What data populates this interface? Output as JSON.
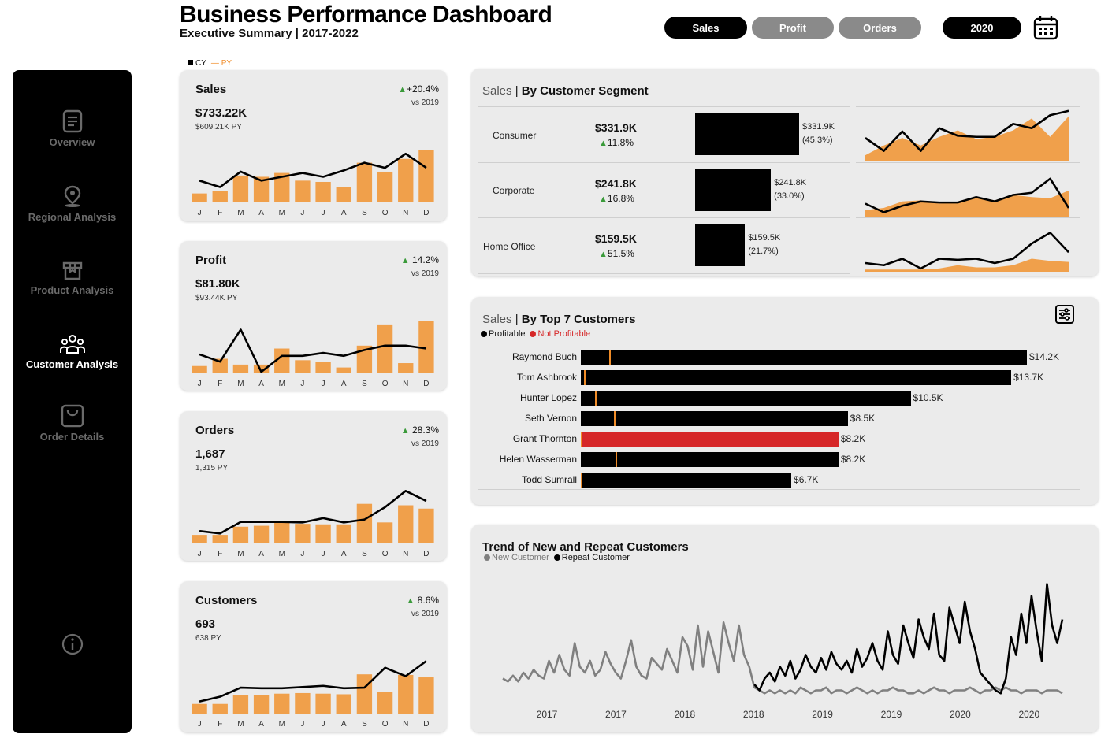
{
  "header": {
    "title": "Business Performance Dashboard",
    "subtitle": "Executive Summary | 2017-2022",
    "metric_tabs": [
      {
        "label": "Sales",
        "active": true
      },
      {
        "label": "Profit",
        "active": false
      },
      {
        "label": "Orders",
        "active": false
      }
    ],
    "year_label": "2020",
    "calendar_icon": "calendar-icon"
  },
  "legend": {
    "cy": "CY",
    "py": "PY",
    "py_color": "#f08c28"
  },
  "sidebar": {
    "items": [
      {
        "label": "Overview",
        "icon": "document-icon",
        "active": false
      },
      {
        "label": "Regional Analysis",
        "icon": "map-pin-icon",
        "active": false
      },
      {
        "label": "Product Analysis",
        "icon": "box-icon",
        "active": false
      },
      {
        "label": "Customer Analysis",
        "icon": "users-icon",
        "active": true
      },
      {
        "label": "Order Details",
        "icon": "shopping-bag-icon",
        "active": false
      }
    ],
    "info_icon": "info-icon"
  },
  "kpis": [
    {
      "name": "Sales",
      "value": "$733.22K",
      "py": "$609.21K PY",
      "delta": "+20.4%",
      "vs": "vs 2019",
      "months": [
        "J",
        "F",
        "M",
        "A",
        "M",
        "J",
        "J",
        "A",
        "S",
        "O",
        "N",
        "D"
      ],
      "bars": [
        7,
        9,
        21,
        20,
        23,
        17,
        16,
        12,
        31,
        24,
        34,
        41
      ],
      "line": [
        17,
        12,
        24,
        17,
        20,
        23,
        20,
        25,
        31,
        27,
        38,
        27
      ]
    },
    {
      "name": "Profit",
      "value": "$81.80K",
      "py": "$93.44K PY",
      "delta": "14.2%",
      "vs": "vs 2019",
      "months": [
        "J",
        "F",
        "M",
        "A",
        "M",
        "J",
        "J",
        "A",
        "S",
        "O",
        "N",
        "D"
      ],
      "bars": [
        5,
        10,
        6,
        6,
        17,
        9,
        8,
        4,
        19,
        33,
        7,
        36
      ],
      "line": [
        13,
        8,
        30,
        1,
        12,
        12,
        14,
        12,
        16,
        19,
        19,
        17
      ]
    },
    {
      "name": "Orders",
      "value": "1,687",
      "py": "1,315 PY",
      "delta": "28.3%",
      "vs": "vs 2019",
      "months": [
        "J",
        "F",
        "M",
        "A",
        "M",
        "J",
        "J",
        "A",
        "S",
        "O",
        "N",
        "D"
      ],
      "bars": [
        18,
        18,
        35,
        37,
        44,
        41,
        40,
        40,
        83,
        44,
        80,
        73
      ],
      "line": [
        26,
        21,
        45,
        45,
        45,
        44,
        53,
        44,
        50,
        76,
        110,
        89
      ]
    },
    {
      "name": "Customers",
      "value": "693",
      "py": "638 PY",
      "delta": "8.6%",
      "vs": "vs 2019",
      "months": [
        "J",
        "F",
        "M",
        "A",
        "M",
        "J",
        "J",
        "A",
        "S",
        "O",
        "N",
        "D"
      ],
      "bars": [
        16,
        16,
        30,
        31,
        33,
        34,
        33,
        32,
        65,
        36,
        64,
        60
      ],
      "line": [
        20,
        28,
        43,
        42,
        42,
        44,
        46,
        42,
        43,
        76,
        62,
        87
      ]
    }
  ],
  "segments": {
    "title_prefix": "Sales",
    "title": "By Customer Segment",
    "rows": [
      {
        "name": "Consumer",
        "value": "$331.9K",
        "growth": "11.8%",
        "bar_label": "$331.9K",
        "share": "(45.3%)",
        "share_value": 45.3,
        "area": [
          5,
          14,
          21,
          14,
          22,
          28,
          20,
          22,
          28,
          39,
          22,
          41
        ],
        "line": [
          21,
          9,
          27,
          9,
          30,
          23,
          22,
          22,
          34,
          30,
          42,
          46
        ]
      },
      {
        "name": "Corporate",
        "value": "$241.8K",
        "growth": "16.8%",
        "bar_label": "$241.8K",
        "share": "(33.0%)",
        "share_value": 33.0,
        "area": [
          6,
          8,
          14,
          15,
          12,
          14,
          18,
          15,
          20,
          18,
          17,
          24
        ],
        "line": [
          12,
          4,
          10,
          14,
          13,
          13,
          18,
          14,
          20,
          22,
          35,
          8
        ]
      },
      {
        "name": "Home Office",
        "value": "$159.5K",
        "growth": "51.5%",
        "bar_label": "$159.5K",
        "share": "(21.7%)",
        "share_value": 21.7,
        "area": [
          2,
          2,
          2,
          2,
          3,
          6,
          4,
          4,
          6,
          12,
          10,
          9
        ],
        "line": [
          8,
          6,
          12,
          3,
          12,
          11,
          12,
          8,
          12,
          26,
          36,
          18
        ]
      }
    ]
  },
  "top_customers": {
    "title_prefix": "Sales",
    "title": "By Top 7 Customers",
    "legend_profitable": "Profitable",
    "legend_not_profitable": "Not Profitable",
    "filter_icon": "sliders-icon",
    "profitable_color": "#000000",
    "not_profitable_color": "#d62728",
    "rows": [
      {
        "name": "Raymond Buch",
        "value": 14.2,
        "label": "$14.2K",
        "py": 0.9,
        "profitable": true
      },
      {
        "name": "Tom Ashbrook",
        "value": 13.7,
        "label": "$13.7K",
        "py": 0.1,
        "profitable": true
      },
      {
        "name": "Hunter Lopez",
        "value": 10.5,
        "label": "$10.5K",
        "py": 0.45,
        "profitable": true
      },
      {
        "name": "Seth Vernon",
        "value": 8.5,
        "label": "$8.5K",
        "py": 1.05,
        "profitable": true
      },
      {
        "name": "Grant Thornton",
        "value": 8.2,
        "label": "$8.2K",
        "py": 0.0,
        "profitable": false
      },
      {
        "name": "Helen Wasserman",
        "value": 8.2,
        "label": "$8.2K",
        "py": 1.1,
        "profitable": true
      },
      {
        "name": "Todd Sumrall",
        "value": 6.7,
        "label": "$6.7K",
        "py": 0.0,
        "profitable": true
      }
    ]
  },
  "trend": {
    "title": "Trend of New and Repeat Customers",
    "legend_new": "New Customer",
    "legend_repeat": "Repeat Customer",
    "new_color": "#808080",
    "repeat_color": "#000000",
    "x_labels": [
      "2017",
      "2017",
      "2018",
      "2018",
      "2019",
      "2019",
      "2020",
      "2020"
    ]
  },
  "chart_data": [
    {
      "type": "bar",
      "title": "Sales",
      "categories": [
        "J",
        "F",
        "M",
        "A",
        "M",
        "J",
        "J",
        "A",
        "S",
        "O",
        "N",
        "D"
      ],
      "series": [
        {
          "name": "CY",
          "values": [
            7,
            9,
            21,
            20,
            23,
            17,
            16,
            12,
            31,
            24,
            34,
            41
          ]
        },
        {
          "name": "PY",
          "values": [
            17,
            12,
            24,
            17,
            20,
            23,
            20,
            25,
            31,
            27,
            38,
            27
          ]
        }
      ]
    },
    {
      "type": "bar",
      "title": "By Top 7 Customers",
      "categories": [
        "Raymond Buch",
        "Tom Ashbrook",
        "Hunter Lopez",
        "Seth Vernon",
        "Grant Thornton",
        "Helen Wasserman",
        "Todd Sumrall"
      ],
      "values": [
        14.2,
        13.7,
        10.5,
        8.5,
        8.2,
        8.2,
        6.7
      ]
    },
    {
      "type": "line",
      "title": "Trend of New and Repeat Customers",
      "series": [
        {
          "name": "New Customer",
          "values": [
            6,
            5,
            7,
            5,
            8,
            6,
            9,
            7,
            6,
            12,
            8,
            14,
            9,
            7,
            18,
            10,
            8,
            12,
            7,
            9,
            15,
            11,
            8,
            6,
            12,
            19,
            10,
            7,
            6,
            13,
            11,
            9,
            16,
            12,
            8,
            20,
            17,
            9,
            24,
            10,
            22,
            15,
            8,
            25,
            18,
            12,
            24,
            14,
            10,
            3,
            2,
            1,
            2,
            1,
            2,
            1,
            2,
            1,
            3,
            2,
            1,
            2,
            2,
            3,
            1,
            2,
            2,
            1,
            2,
            3,
            2,
            1,
            2,
            1,
            2,
            2,
            3,
            2,
            2,
            1,
            1,
            2,
            1,
            2,
            3,
            2,
            2,
            1,
            2,
            2,
            2,
            3,
            2,
            1,
            2,
            2,
            3,
            2,
            3,
            2,
            2,
            1,
            2,
            2,
            2,
            1,
            2,
            2,
            2,
            1
          ]
        },
        {
          "name": "Repeat Customer",
          "values": [
            null,
            null,
            null,
            null,
            null,
            null,
            null,
            null,
            null,
            null,
            null,
            null,
            null,
            null,
            null,
            null,
            null,
            null,
            null,
            null,
            null,
            null,
            null,
            null,
            null,
            null,
            null,
            null,
            null,
            null,
            null,
            null,
            null,
            null,
            null,
            null,
            null,
            null,
            null,
            null,
            null,
            null,
            null,
            null,
            null,
            null,
            null,
            null,
            null,
            4,
            2,
            6,
            8,
            5,
            10,
            7,
            12,
            6,
            9,
            14,
            10,
            8,
            13,
            9,
            15,
            11,
            9,
            12,
            8,
            16,
            10,
            13,
            18,
            12,
            9,
            22,
            14,
            11,
            24,
            18,
            13,
            26,
            20,
            16,
            28,
            14,
            12,
            30,
            24,
            18,
            32,
            22,
            16,
            8,
            6,
            4,
            2,
            1,
            6,
            20,
            14,
            28,
            18,
            34,
            22,
            12,
            38,
            24,
            18,
            26
          ]
        }
      ]
    }
  ]
}
